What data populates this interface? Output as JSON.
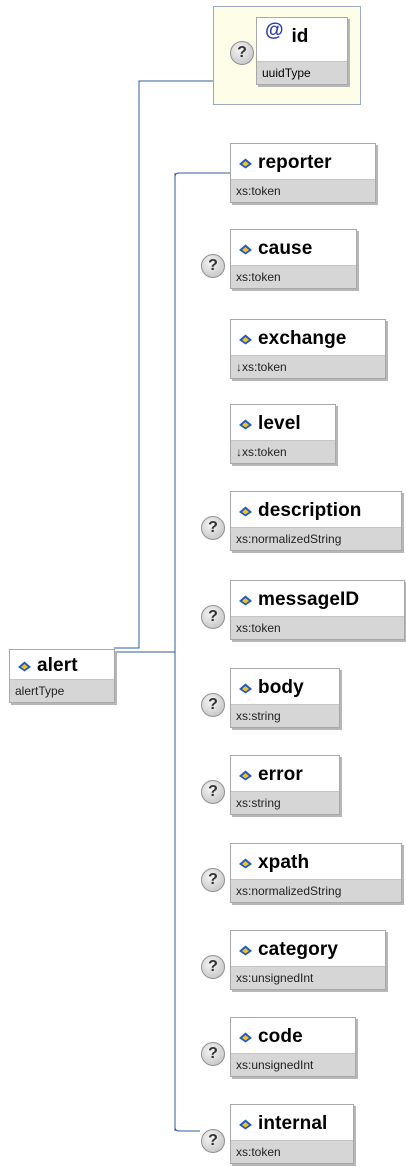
{
  "root": {
    "name": "alert",
    "type": "alertType"
  },
  "attribute": {
    "symbol": "@",
    "name": "id",
    "type": "uuidType",
    "optional_mark": "?"
  },
  "children": [
    {
      "name": "reporter",
      "type": "xs:token",
      "optional": false
    },
    {
      "name": "cause",
      "type": "xs:token",
      "optional": true
    },
    {
      "name": "exchange",
      "type": "↓xs:token",
      "optional": false
    },
    {
      "name": "level",
      "type": "↓xs:token",
      "optional": false
    },
    {
      "name": "description",
      "type": "xs:normalizedString",
      "optional": true
    },
    {
      "name": "messageID",
      "type": "xs:token",
      "optional": true
    },
    {
      "name": "body",
      "type": "xs:string",
      "optional": true
    },
    {
      "name": "error",
      "type": "xs:string",
      "optional": true
    },
    {
      "name": "xpath",
      "type": "xs:normalizedString",
      "optional": true
    },
    {
      "name": "category",
      "type": "xs:unsignedInt",
      "optional": true
    },
    {
      "name": "code",
      "type": "xs:unsignedInt",
      "optional": true
    },
    {
      "name": "internal",
      "type": "xs:token",
      "optional": true
    }
  ],
  "optional_mark": "?",
  "colors": {
    "connector": "#2f5d9e",
    "icon_blue": "#1f57c8",
    "icon_yellow": "#f2c21b",
    "type_band": "#d6d6d6"
  },
  "icons": {
    "element": "element-icon",
    "optional": "optional-question-icon",
    "attribute": "at-sign-icon"
  }
}
